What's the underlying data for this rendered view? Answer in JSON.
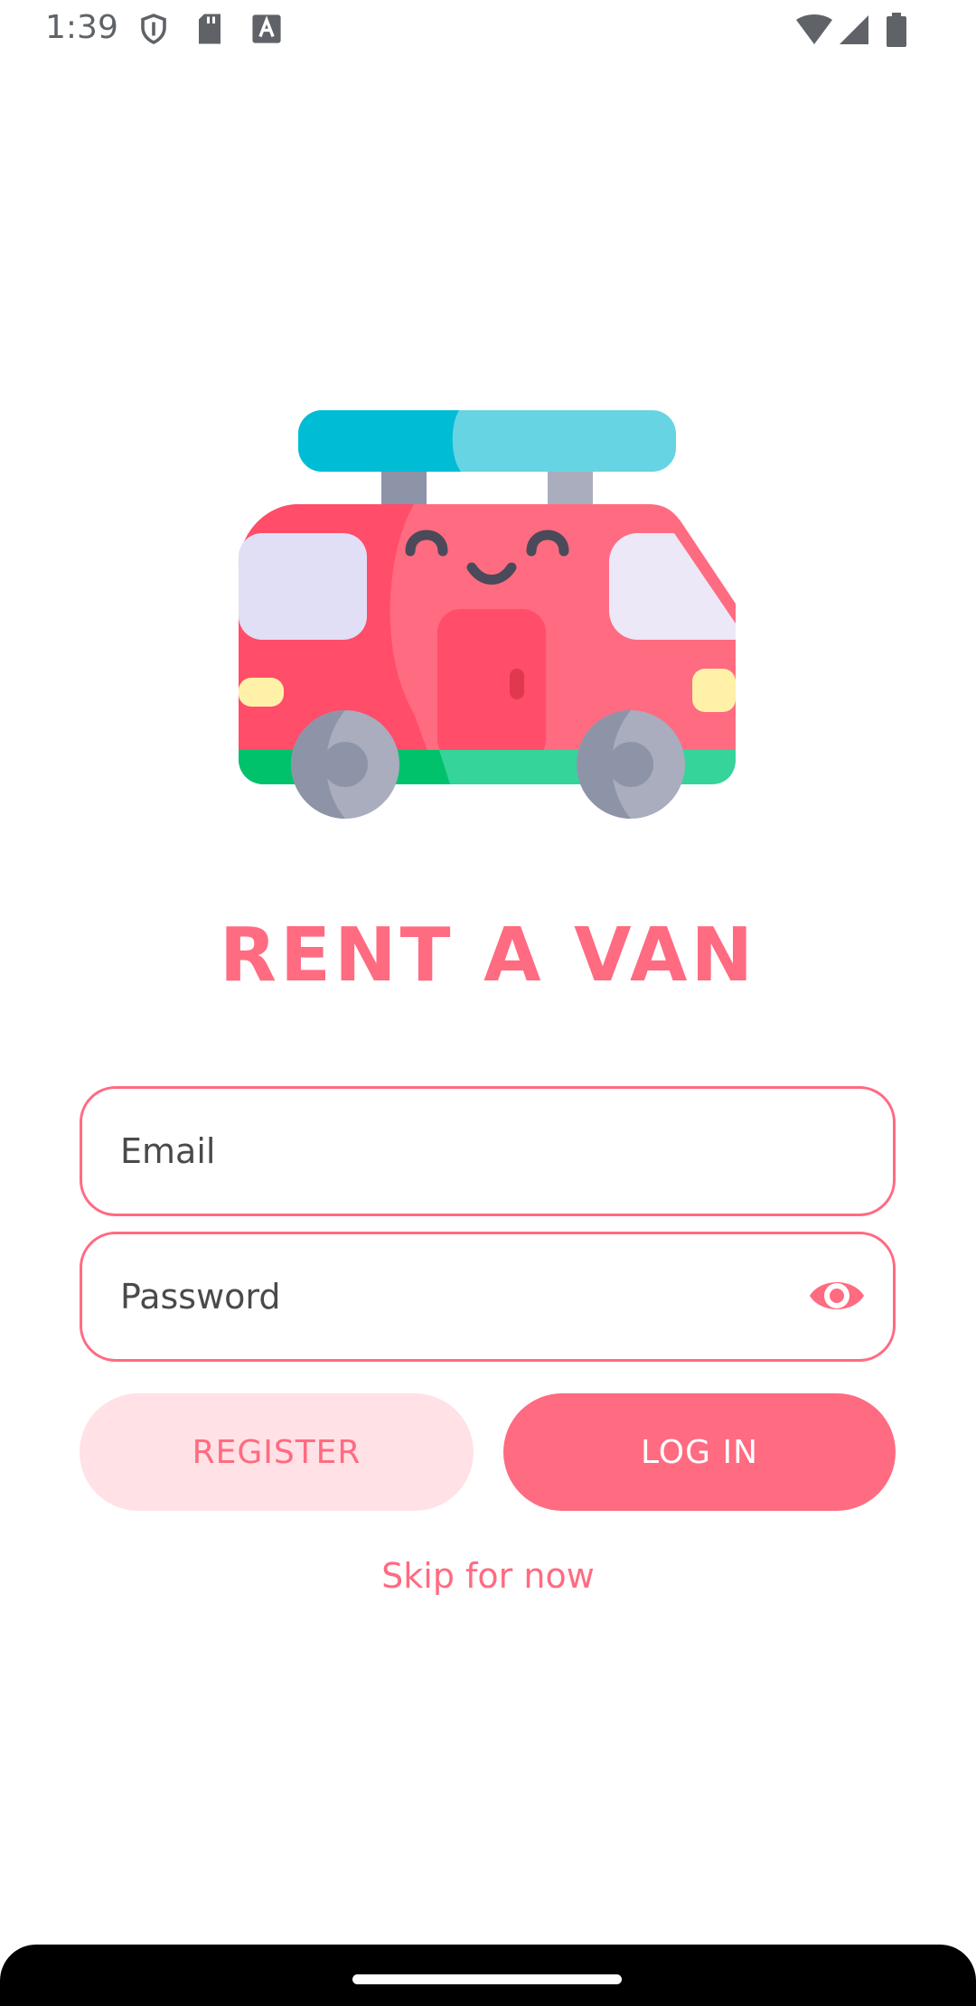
{
  "status_bar": {
    "time": "1:39",
    "icons": [
      "shield-icon",
      "sd-card-icon",
      "keyboard-a-icon",
      "wifi-icon",
      "signal-icon",
      "battery-icon"
    ]
  },
  "app": {
    "title": "RENT A VAN",
    "logo": "van-icon",
    "accent_color": "#ff6b81",
    "accent_light_color": "#ffe1e6"
  },
  "form": {
    "email": {
      "placeholder": "Email",
      "value": ""
    },
    "password": {
      "placeholder": "Password",
      "value": "",
      "toggle_icon": "eye-icon"
    }
  },
  "buttons": {
    "register_label": "REGISTER",
    "login_label": "LOG IN"
  },
  "skip_label": "Skip for now"
}
